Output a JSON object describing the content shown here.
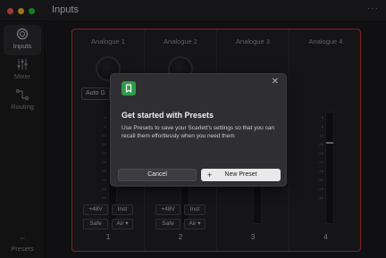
{
  "window": {
    "title": "Inputs",
    "more": "···"
  },
  "sidebar": {
    "items": [
      {
        "label": "Inputs",
        "icon": "inputs-icon"
      },
      {
        "label": "Mixer",
        "icon": "mixer-icon"
      },
      {
        "label": "Routing",
        "icon": "routing-icon"
      }
    ],
    "presets": {
      "label": "Presets",
      "icon": "presets-icon"
    }
  },
  "channels": [
    {
      "name": "Analogue 1",
      "number": "1",
      "auto": "Auto G",
      "p48": "+48V",
      "inst": "Inst",
      "safe": "Safe",
      "air": "Air ▾"
    },
    {
      "name": "Analogue 2",
      "number": "2",
      "p48": "+48V",
      "inst": "Inst",
      "safe": "Safe",
      "air": "Air ▾"
    },
    {
      "name": "Analogue 3",
      "number": "3"
    },
    {
      "name": "Analogue 4",
      "number": "4"
    }
  ],
  "meter_ticks": [
    "0",
    "-6",
    "-12",
    "-18",
    "-24",
    "-30",
    "-36",
    "-42",
    "-48",
    "-60"
  ],
  "modal": {
    "title": "Get started with Presets",
    "body": "Use Presets to save your Scarlett's settings so that you can recall them effortlessly when you need them",
    "close": "✕",
    "cancel_label": "Cancel",
    "new_preset_label": "New Preset",
    "plus": "+"
  },
  "colors": {
    "accent_border": "#c63b3b",
    "preset_icon": "#2f9a4b"
  }
}
